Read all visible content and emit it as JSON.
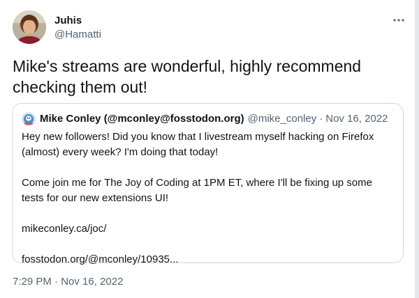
{
  "tweet": {
    "author_name": "Juhis",
    "author_handle": "@Hamatti",
    "text": "Mike's streams are wonderful, highly recommend checking them out!",
    "timestamp": "7:29 PM · Nov 16, 2022",
    "more_icon": "more-horizontal-icon"
  },
  "quote": {
    "author_name": "Mike Conley (@mconley@fosstodon.org)",
    "author_handle": "@mike_conley",
    "separator": "·",
    "date": "Nov 16, 2022",
    "paragraphs": [
      "Hey new followers! Did you know that I livestream myself hacking on Firefox (almost) every week? I'm doing that today!",
      "Come join me for The Joy of Coding at 1PM ET, where I'll be fixing up some tests for our new extensions UI!"
    ],
    "links": [
      "mikeconley.ca/joc/",
      "fosstodon.org/@mconley/10935..."
    ]
  },
  "colors": {
    "text_primary": "#0f1419",
    "text_secondary": "#536471",
    "border": "#cfd9de"
  }
}
